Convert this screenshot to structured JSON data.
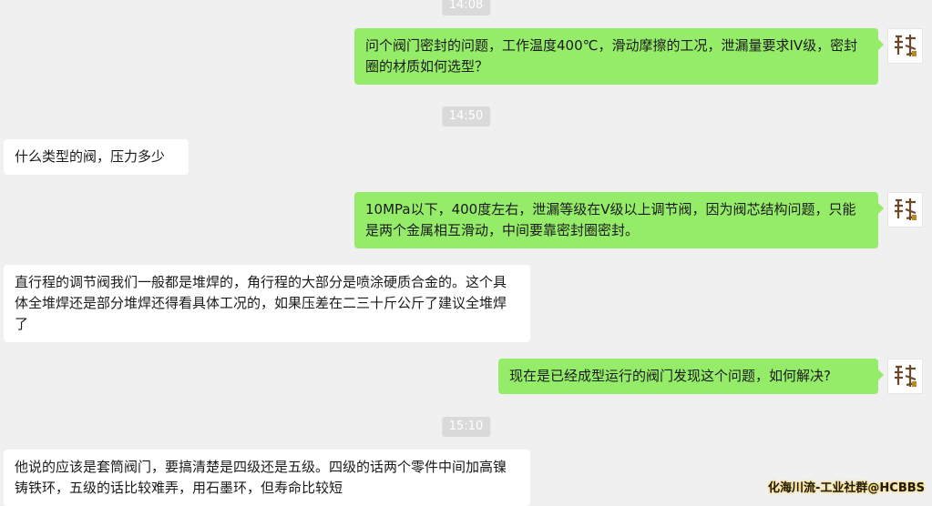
{
  "timestamps": [
    "14:08",
    "14:50",
    "15:10"
  ],
  "messages": [
    {
      "sender": "self",
      "text": "问个阀门密封的问题，工作温度400℃，滑动摩擦的工况，泄漏量要求IV级，密封圈的材质如何选型？"
    },
    {
      "sender": "other",
      "text": "什么类型的阀，压力多少"
    },
    {
      "sender": "self",
      "text": "10MPa以下，400度左右，泄漏等级在V级以上调节阀，因为阀芯结构问题，只能是两个金属相互滑动，中间要靠密封圈密封。"
    },
    {
      "sender": "other",
      "text": "直行程的调节阀我们一般都是堆焊的，角行程的大部分是喷涂硬质合金的。这个具体全堆焊还是部分堆焊还得看具体工况的，如果压差在二三十斤公斤了建议全堆焊了"
    },
    {
      "sender": "self",
      "text": "现在是已经成型运行的阀门发现这个问题，如何解决?"
    },
    {
      "sender": "other",
      "text": "他说的应该是套筒阀门，要搞清楚是四级还是五级。四级的话两个零件中间加高镍铸铁环，五级的话比较难弄，用石墨环，但寿命比较短"
    }
  ],
  "watermark": "化海川流-工业社群@HCBBS",
  "colors": {
    "background": "#f0f0f0",
    "outgoing_bubble": "#95ec69",
    "incoming_bubble": "#ffffff",
    "timestamp_bg": "#dadada"
  }
}
